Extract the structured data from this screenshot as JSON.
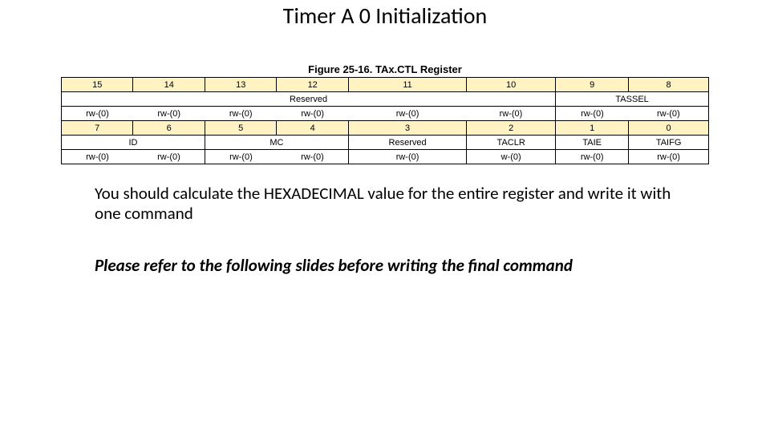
{
  "title": "Timer A 0 Initialization",
  "figure_caption": "Figure 25-16. TAx.CTL Register",
  "table": {
    "row1_bits": [
      "15",
      "14",
      "13",
      "12",
      "11",
      "10",
      "9",
      "8"
    ],
    "row2_fields": {
      "reserved": "Reserved",
      "tassel": "TASSEL"
    },
    "row3_rw": [
      "rw-(0)",
      "rw-(0)",
      "rw-(0)",
      "rw-(0)",
      "rw-(0)",
      "rw-(0)",
      "rw-(0)",
      "rw-(0)"
    ],
    "row4_bits": [
      "7",
      "6",
      "5",
      "4",
      "3",
      "2",
      "1",
      "0"
    ],
    "row5_fields": {
      "id": "ID",
      "mc": "MC",
      "reserved": "Reserved",
      "taclr": "TACLR",
      "taie": "TAIE",
      "taifg": "TAIFG"
    },
    "row6_rw": [
      "rw-(0)",
      "rw-(0)",
      "rw-(0)",
      "rw-(0)",
      "rw-(0)",
      "w-(0)",
      "rw-(0)",
      "rw-(0)"
    ]
  },
  "para1": "You should calculate the HEXADECIMAL value for the entire register and write it with one command",
  "para2": "Please refer to the following slides before writing the final command"
}
